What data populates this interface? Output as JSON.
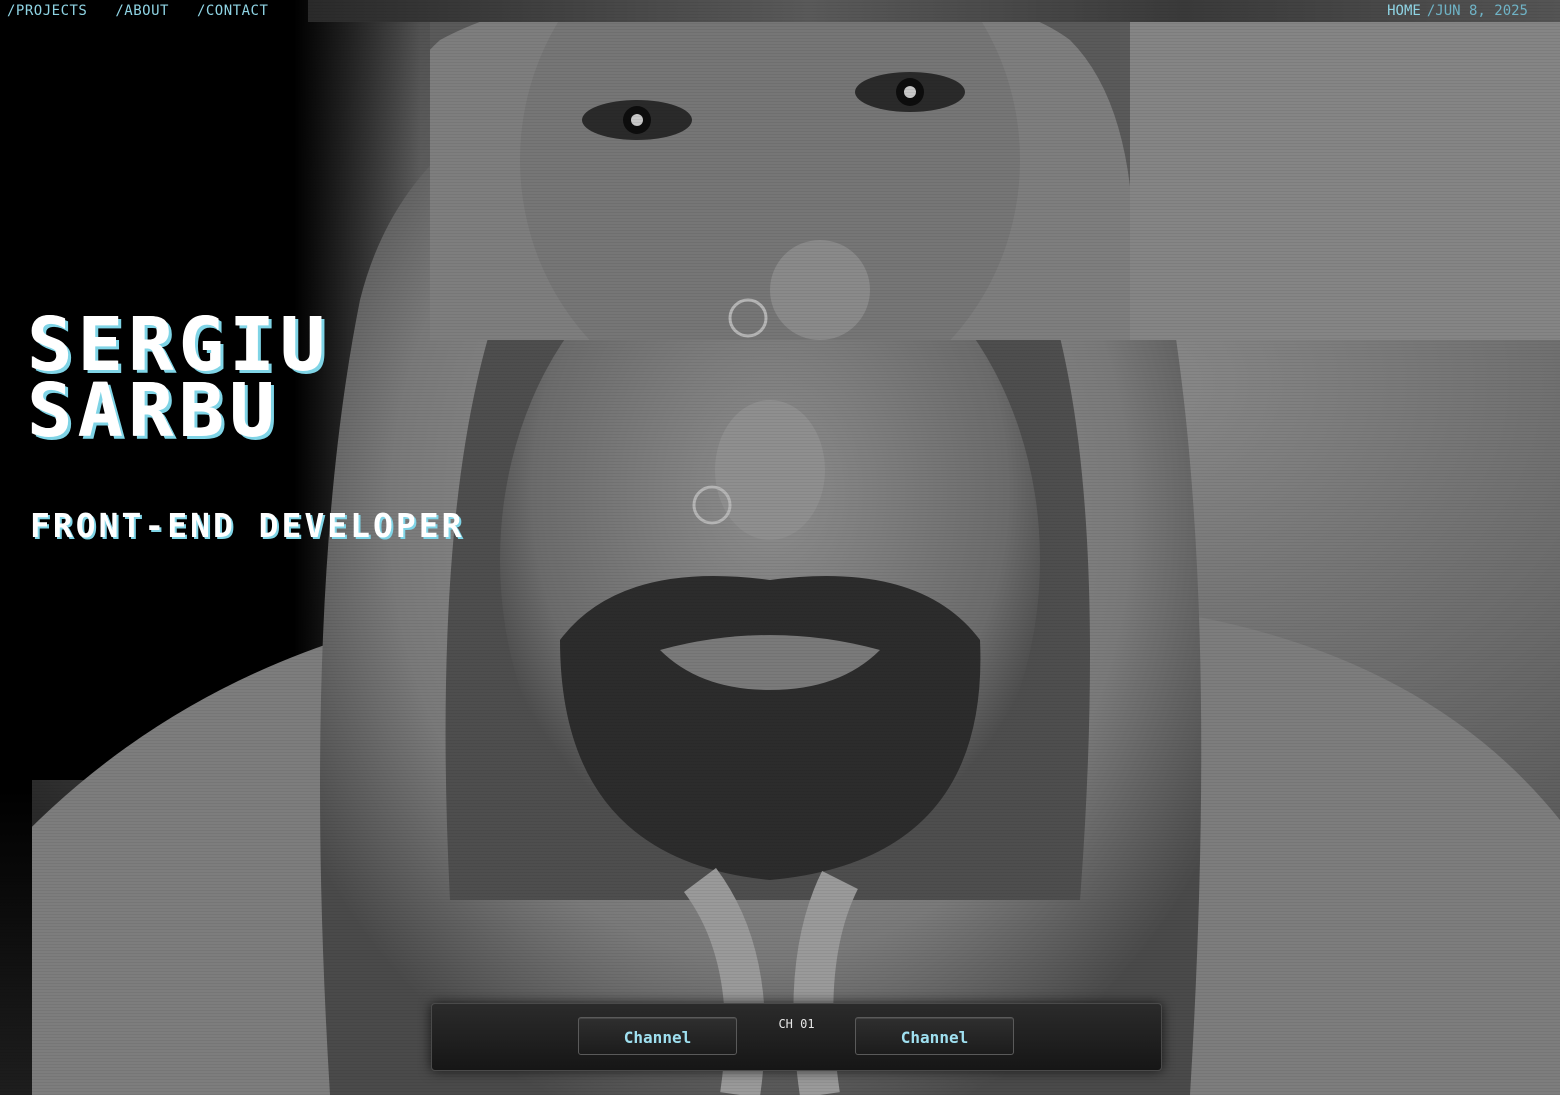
{
  "nav": {
    "links": [
      {
        "label": "/PROJECTS"
      },
      {
        "label": "/ABOUT"
      },
      {
        "label": "/CONTACT"
      }
    ],
    "home_label": "HOME",
    "date": "/JUN 8, 2025"
  },
  "hero": {
    "first_name": "SERGIU",
    "last_name": "SARBU",
    "role": "FRONT-END DEVELOPER"
  },
  "controls": {
    "channel_label": "CH 01",
    "prev_button": "Channel",
    "next_button": "Channel"
  },
  "colors": {
    "accent": "#8fd4e4",
    "text": "#ffffff",
    "background": "#000000"
  }
}
